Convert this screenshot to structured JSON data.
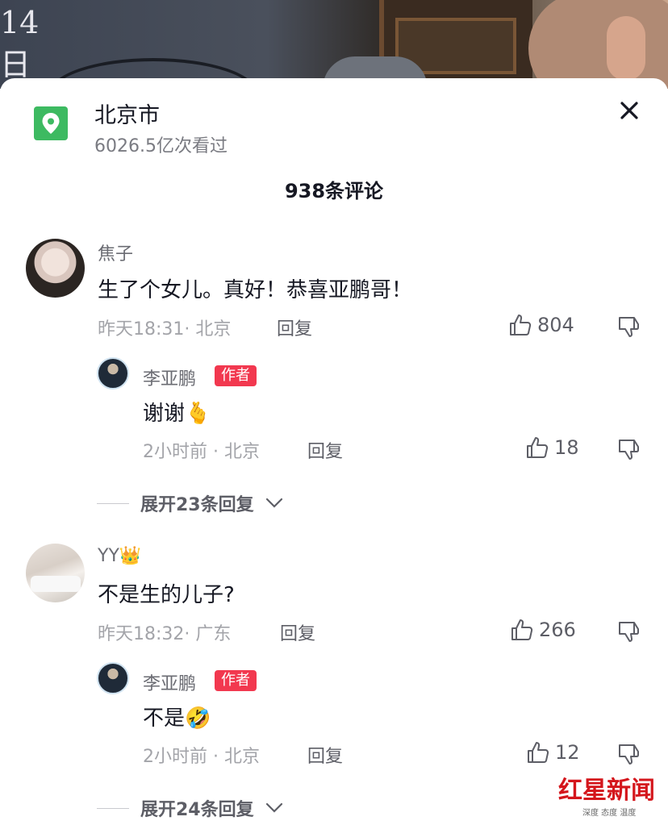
{
  "video": {
    "date_text": "14\n日"
  },
  "location": {
    "title": "北京市",
    "views": "6026.5亿次看过",
    "icon": "map-pin-icon"
  },
  "close_label": "×",
  "comment_count": "938条评论",
  "comments": [
    {
      "user": "焦子",
      "text": "生了个女儿。真好！恭喜亚鹏哥！",
      "meta": "昨天18:31· 北京",
      "reply_label": "回复",
      "likes": "804",
      "replies": [
        {
          "user": "李亚鹏",
          "badge": "作者",
          "text": "谢谢",
          "emoji": "🫰",
          "meta": "2小时前 · 北京",
          "reply_label": "回复",
          "likes": "18"
        }
      ],
      "expand": "展开23条回复"
    },
    {
      "user": "YY",
      "user_emoji": "👑",
      "text": "不是生的儿子?",
      "meta": "昨天18:32· 广东",
      "reply_label": "回复",
      "likes": "266",
      "replies": [
        {
          "user": "李亚鹏",
          "badge": "作者",
          "text": "不是",
          "emoji": "🤣",
          "meta": "2小时前 · 北京",
          "reply_label": "回复",
          "likes": "12"
        }
      ],
      "expand": "展开24条回复"
    }
  ],
  "watermark": {
    "main": "红星新闻",
    "sub": "深度 态度 温度"
  },
  "colors": {
    "accent_green": "#3dba61",
    "author_badge": "#f2384f",
    "watermark_red": "#d4161c"
  }
}
